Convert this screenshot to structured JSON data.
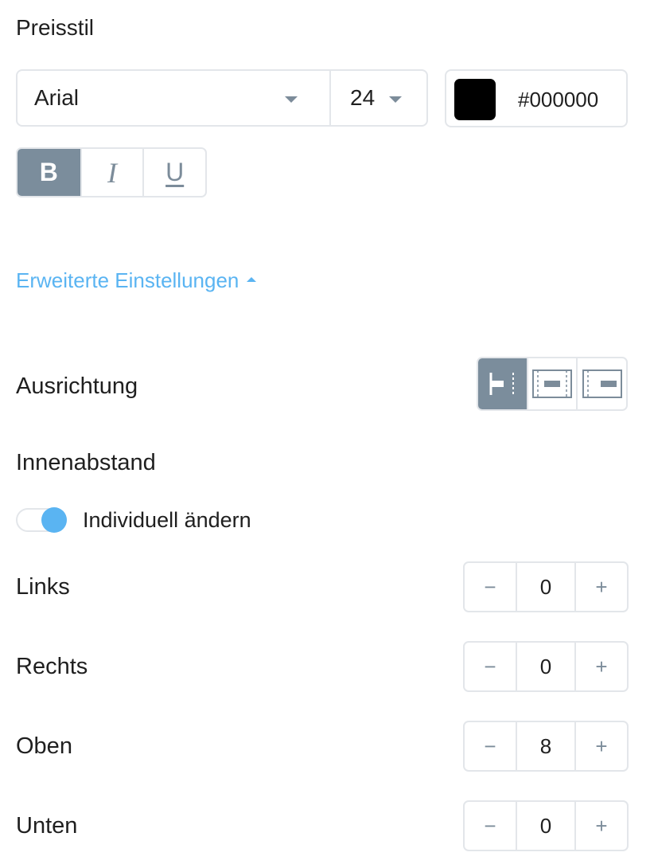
{
  "section_title": "Preisstil",
  "font": {
    "family": "Arial",
    "size": "24"
  },
  "color": {
    "value": "#000000",
    "swatch": "#000000"
  },
  "text_style": {
    "bold": "B",
    "italic": "I",
    "underline": "U",
    "active": "bold"
  },
  "advanced_link": "Erweiterte Einstellungen",
  "alignment": {
    "label": "Ausrichtung",
    "options": [
      "left",
      "center",
      "right"
    ],
    "active": "left"
  },
  "padding": {
    "label": "Innenabstand",
    "toggle_label": "Individuell ändern",
    "toggle_on": true,
    "rows": [
      {
        "label": "Links",
        "value": "0",
        "minus": "−",
        "plus": "+"
      },
      {
        "label": "Rechts",
        "value": "0",
        "minus": "−",
        "plus": "+"
      },
      {
        "label": "Oben",
        "value": "8",
        "minus": "−",
        "plus": "+"
      },
      {
        "label": "Unten",
        "value": "0",
        "minus": "−",
        "plus": "+"
      }
    ]
  },
  "colors": {
    "accent": "#5ab4f2",
    "active_button": "#7b8d9c",
    "icon_gray": "#7c8c9a",
    "border": "#e3e6ea"
  }
}
